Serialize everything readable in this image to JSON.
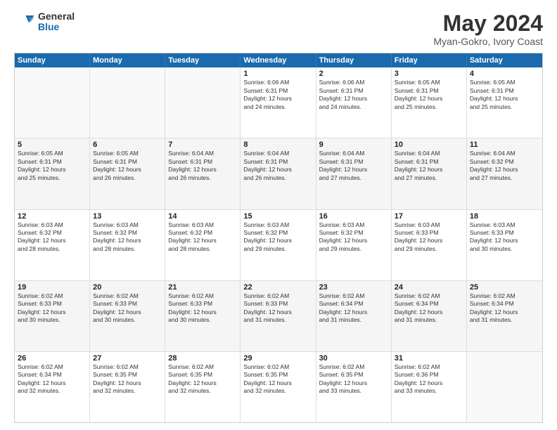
{
  "header": {
    "logo": {
      "general": "General",
      "blue": "Blue"
    },
    "title": "May 2024",
    "location": "Myan-Gokro, Ivory Coast"
  },
  "days": [
    "Sunday",
    "Monday",
    "Tuesday",
    "Wednesday",
    "Thursday",
    "Friday",
    "Saturday"
  ],
  "weeks": [
    [
      {
        "day": "",
        "content": ""
      },
      {
        "day": "",
        "content": ""
      },
      {
        "day": "",
        "content": ""
      },
      {
        "day": "1",
        "content": "Sunrise: 6:06 AM\nSunset: 6:31 PM\nDaylight: 12 hours\nand 24 minutes."
      },
      {
        "day": "2",
        "content": "Sunrise: 6:06 AM\nSunset: 6:31 PM\nDaylight: 12 hours\nand 24 minutes."
      },
      {
        "day": "3",
        "content": "Sunrise: 6:05 AM\nSunset: 6:31 PM\nDaylight: 12 hours\nand 25 minutes."
      },
      {
        "day": "4",
        "content": "Sunrise: 6:05 AM\nSunset: 6:31 PM\nDaylight: 12 hours\nand 25 minutes."
      }
    ],
    [
      {
        "day": "5",
        "content": "Sunrise: 6:05 AM\nSunset: 6:31 PM\nDaylight: 12 hours\nand 25 minutes."
      },
      {
        "day": "6",
        "content": "Sunrise: 6:05 AM\nSunset: 6:31 PM\nDaylight: 12 hours\nand 26 minutes."
      },
      {
        "day": "7",
        "content": "Sunrise: 6:04 AM\nSunset: 6:31 PM\nDaylight: 12 hours\nand 26 minutes."
      },
      {
        "day": "8",
        "content": "Sunrise: 6:04 AM\nSunset: 6:31 PM\nDaylight: 12 hours\nand 26 minutes."
      },
      {
        "day": "9",
        "content": "Sunrise: 6:04 AM\nSunset: 6:31 PM\nDaylight: 12 hours\nand 27 minutes."
      },
      {
        "day": "10",
        "content": "Sunrise: 6:04 AM\nSunset: 6:31 PM\nDaylight: 12 hours\nand 27 minutes."
      },
      {
        "day": "11",
        "content": "Sunrise: 6:04 AM\nSunset: 6:32 PM\nDaylight: 12 hours\nand 27 minutes."
      }
    ],
    [
      {
        "day": "12",
        "content": "Sunrise: 6:03 AM\nSunset: 6:32 PM\nDaylight: 12 hours\nand 28 minutes."
      },
      {
        "day": "13",
        "content": "Sunrise: 6:03 AM\nSunset: 6:32 PM\nDaylight: 12 hours\nand 28 minutes."
      },
      {
        "day": "14",
        "content": "Sunrise: 6:03 AM\nSunset: 6:32 PM\nDaylight: 12 hours\nand 28 minutes."
      },
      {
        "day": "15",
        "content": "Sunrise: 6:03 AM\nSunset: 6:32 PM\nDaylight: 12 hours\nand 29 minutes."
      },
      {
        "day": "16",
        "content": "Sunrise: 6:03 AM\nSunset: 6:32 PM\nDaylight: 12 hours\nand 29 minutes."
      },
      {
        "day": "17",
        "content": "Sunrise: 6:03 AM\nSunset: 6:33 PM\nDaylight: 12 hours\nand 29 minutes."
      },
      {
        "day": "18",
        "content": "Sunrise: 6:03 AM\nSunset: 6:33 PM\nDaylight: 12 hours\nand 30 minutes."
      }
    ],
    [
      {
        "day": "19",
        "content": "Sunrise: 6:02 AM\nSunset: 6:33 PM\nDaylight: 12 hours\nand 30 minutes."
      },
      {
        "day": "20",
        "content": "Sunrise: 6:02 AM\nSunset: 6:33 PM\nDaylight: 12 hours\nand 30 minutes."
      },
      {
        "day": "21",
        "content": "Sunrise: 6:02 AM\nSunset: 6:33 PM\nDaylight: 12 hours\nand 30 minutes."
      },
      {
        "day": "22",
        "content": "Sunrise: 6:02 AM\nSunset: 6:33 PM\nDaylight: 12 hours\nand 31 minutes."
      },
      {
        "day": "23",
        "content": "Sunrise: 6:02 AM\nSunset: 6:34 PM\nDaylight: 12 hours\nand 31 minutes."
      },
      {
        "day": "24",
        "content": "Sunrise: 6:02 AM\nSunset: 6:34 PM\nDaylight: 12 hours\nand 31 minutes."
      },
      {
        "day": "25",
        "content": "Sunrise: 6:02 AM\nSunset: 6:34 PM\nDaylight: 12 hours\nand 31 minutes."
      }
    ],
    [
      {
        "day": "26",
        "content": "Sunrise: 6:02 AM\nSunset: 6:34 PM\nDaylight: 12 hours\nand 32 minutes."
      },
      {
        "day": "27",
        "content": "Sunrise: 6:02 AM\nSunset: 6:35 PM\nDaylight: 12 hours\nand 32 minutes."
      },
      {
        "day": "28",
        "content": "Sunrise: 6:02 AM\nSunset: 6:35 PM\nDaylight: 12 hours\nand 32 minutes."
      },
      {
        "day": "29",
        "content": "Sunrise: 6:02 AM\nSunset: 6:35 PM\nDaylight: 12 hours\nand 32 minutes."
      },
      {
        "day": "30",
        "content": "Sunrise: 6:02 AM\nSunset: 6:35 PM\nDaylight: 12 hours\nand 33 minutes."
      },
      {
        "day": "31",
        "content": "Sunrise: 6:02 AM\nSunset: 6:36 PM\nDaylight: 12 hours\nand 33 minutes."
      },
      {
        "day": "",
        "content": ""
      }
    ]
  ]
}
